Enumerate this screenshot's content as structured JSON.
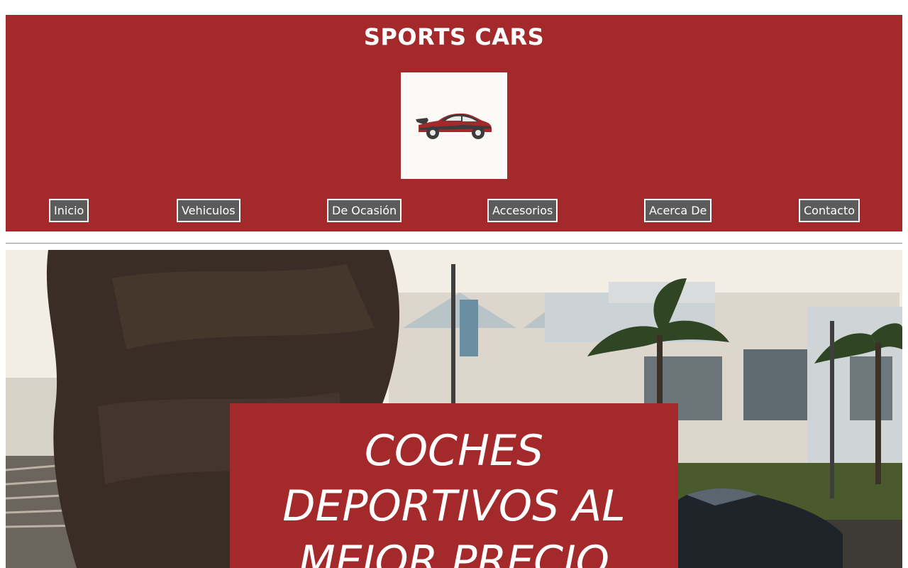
{
  "header": {
    "title": "SPORTS CARS",
    "logo_icon": "sports-car-icon",
    "background_color": "#a4292a"
  },
  "nav": {
    "items": [
      {
        "label": "Inicio"
      },
      {
        "label": "Vehiculos"
      },
      {
        "label": "De Ocasión"
      },
      {
        "label": "Accesorios"
      },
      {
        "label": "Acerca De"
      },
      {
        "label": "Contacto"
      }
    ],
    "button_color": "#5b5b5b"
  },
  "hero": {
    "title": "COCHES DEPORTIVOS AL MEJOR PRECIO",
    "image_description_icon": "street-palm-car-photo"
  }
}
